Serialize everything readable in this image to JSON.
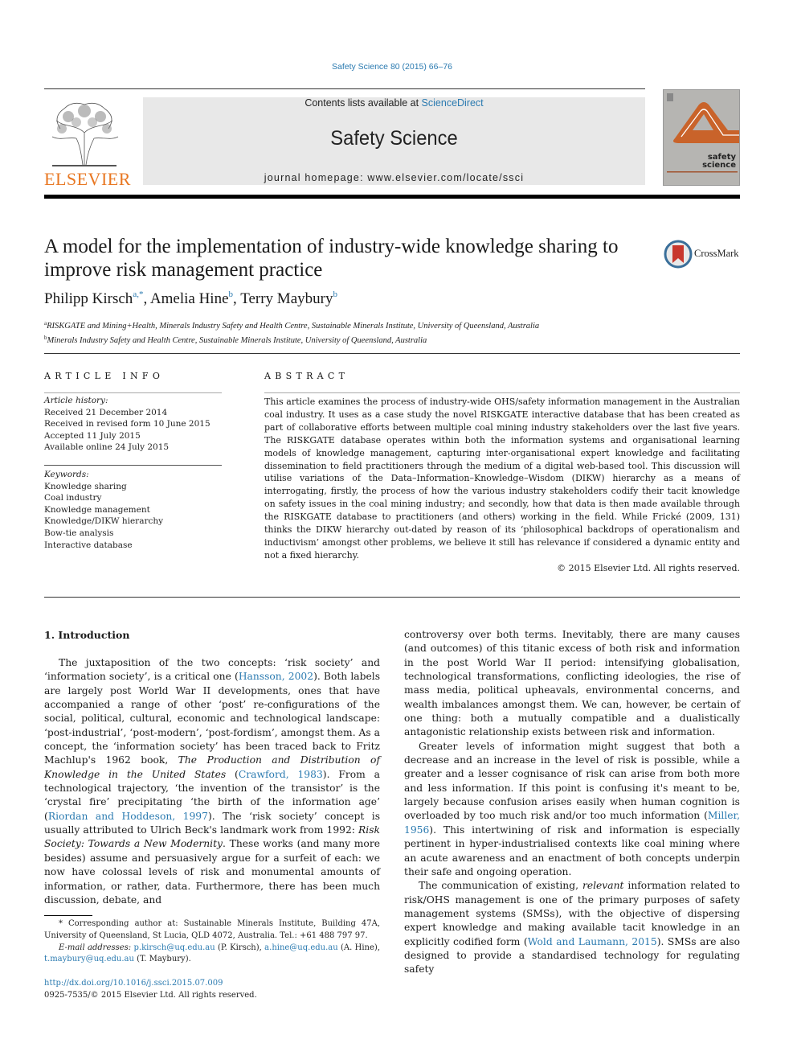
{
  "header": {
    "citation": "Safety Science 80 (2015) 66–76",
    "contents_prefix": "Contents lists available at ",
    "contents_link": "ScienceDirect",
    "journal_title": "Safety Science",
    "homepage": "journal homepage: www.elsevier.com/locate/ssci",
    "publisher": "ELSEVIER",
    "cover_title_line1": "safety",
    "cover_title_line2": "science",
    "crossmark": "CrossMark"
  },
  "article": {
    "title": "A model for the implementation of industry-wide knowledge sharing to improve risk management practice",
    "authors": [
      {
        "name": "Philipp Kirsch",
        "sup": "a,*"
      },
      {
        "name": "Amelia Hine",
        "sup": "b"
      },
      {
        "name": "Terry Maybury",
        "sup": "b"
      }
    ],
    "affiliations": [
      {
        "sup": "a",
        "text": "RISKGATE and Mining+Health, Minerals Industry Safety and Health Centre, Sustainable Minerals Institute, University of Queensland, Australia"
      },
      {
        "sup": "b",
        "text": "Minerals Industry Safety and Health Centre, Sustainable Minerals Institute, University of Queensland, Australia"
      }
    ]
  },
  "article_info": {
    "heading": "ARTICLE INFO",
    "history_label": "Article history:",
    "history": [
      "Received 21 December 2014",
      "Received in revised form 10 June 2015",
      "Accepted 11 July 2015",
      "Available online 24 July 2015"
    ],
    "keywords_label": "Keywords:",
    "keywords": [
      "Knowledge sharing",
      "Coal industry",
      "Knowledge management",
      "Knowledge/DIKW hierarchy",
      "Bow-tie analysis",
      "Interactive database"
    ]
  },
  "abstract": {
    "heading": "ABSTRACT",
    "text": "This article examines the process of industry-wide OHS/safety information management in the Australian coal industry. It uses as a case study the novel RISKGATE interactive database that has been created as part of collaborative efforts between multiple coal mining industry stakeholders over the last five years. The RISKGATE database operates within both the information systems and organisational learning models of knowledge management, capturing inter-organisational expert knowledge and facilitating dissemination to field practitioners through the medium of a digital web-based tool. This discussion will utilise variations of the Data–Information–Knowledge–Wisdom (DIKW) hierarchy as a means of interrogating, firstly, the process of how the various industry stakeholders codify their tacit knowledge on safety issues in the coal mining industry; and secondly, how that data is then made available through the RISKGATE database to practitioners (and others) working in the field. While Frické (2009, 131) thinks the DIKW hierarchy out-dated by reason of its ‘philosophical backdrops of operationalism and inductivism’ amongst other problems, we believe it still has relevance if considered a dynamic entity and not a fixed hierarchy.",
    "copyright": "© 2015 Elsevier Ltd. All rights reserved."
  },
  "body": {
    "section_heading": "1. Introduction",
    "left": {
      "p1_a": "The juxtaposition of the two concepts: ‘risk society’ and ‘information society’, is a critical one (",
      "p1_ref1": "Hansson, 2002",
      "p1_b": "). Both labels are largely post World War II developments, ones that have accompanied a range of other ‘post’ re-configurations of the social, political, cultural, economic and technological landscape: ‘post-industrial’, ‘post-modern’, ‘post-fordism’, amongst them. As a concept, the ‘information society’ has been traced back to Fritz Machlup's 1962 book, ",
      "p1_ital1": "The Production and Distribution of Knowledge in the United States",
      "p1_c": " (",
      "p1_ref2": "Crawford, 1983",
      "p1_d": "). From a technological trajectory, ‘the invention of the transistor’ is the ‘crystal fire’ precipitating ‘the birth of the information age’ (",
      "p1_ref3": "Riordan and Hoddeson, 1997",
      "p1_e": "). The ‘risk society’ concept is usually attributed to Ulrich Beck's landmark work from 1992: ",
      "p1_ital2": "Risk Society: Towards a New Modernity",
      "p1_f": ". These works (and many more besides) assume and persuasively argue for a surfeit of each: we now have colossal levels of risk and monumental amounts of information, or rather, data. Furthermore, there has been much discussion, debate, and"
    },
    "right": {
      "p1": "controversy over both terms. Inevitably, there are many causes (and outcomes) of this titanic excess of both risk and information in the post World War II period: intensifying globalisation, technological transformations, conflicting ideologies, the rise of mass media, political upheavals, environmental concerns, and wealth imbalances amongst them. We can, however, be certain of one thing: both a mutually compatible and a dualistically antagonistic relationship exists between risk and information.",
      "p2_a": "Greater levels of information might suggest that both a decrease and an increase in the level of risk is possible, while a greater and a lesser cognisance of risk can arise from both more and less information. If this point is confusing it's meant to be, largely because confusion arises easily when human cognition is overloaded by too much risk and/or too much information (",
      "p2_ref": "Miller, 1956",
      "p2_b": "). This intertwining of risk and information is especially pertinent in hyper-industrialised contexts like coal mining where an acute awareness and an enactment of both concepts underpin their safe and ongoing operation.",
      "p3_a": "The communication of existing, ",
      "p3_ital": "relevant",
      "p3_b": " information related to risk/OHS management is one of the primary purposes of safety management systems (SMSs), with the objective of dispersing expert knowledge and making available tacit knowledge in an explicitly codified form (",
      "p3_ref": "Wold and Laumann, 2015",
      "p3_c": "). SMSs are also designed to provide a standardised technology for regulating safety"
    }
  },
  "footnotes": {
    "corresponding": "* Corresponding author at: Sustainable Minerals Institute, Building 47A, University of Queensland, St Lucia, QLD 4072, Australia. Tel.: +61 488 797 97.",
    "email_label": "E-mail addresses:",
    "email1": "p.kirsch@uq.edu.au",
    "email1_name": " (P. Kirsch), ",
    "email2": "a.hine@uq.edu.au",
    "email2_name": " (A. Hine), ",
    "email3": "t.maybury@uq.edu.au",
    "email3_name": " (T. Maybury).",
    "doi": "http://dx.doi.org/10.1016/j.ssci.2015.07.009",
    "issn": "0925-7535/© 2015 Elsevier Ltd. All rights reserved."
  }
}
